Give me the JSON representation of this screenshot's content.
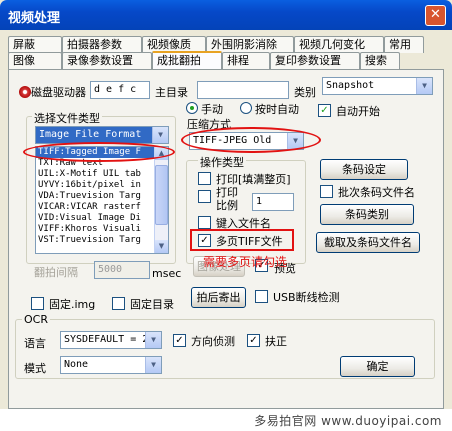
{
  "window": {
    "title": "视频处理",
    "close": "✕"
  },
  "tabs_row1": [
    "屏蔽",
    "拍摄器参数",
    "视频像质",
    "外围阴影消除",
    "视频几何变化",
    "常用"
  ],
  "tabs_row2": [
    "图像",
    "录像参数设置",
    "成批翻拍",
    "排程",
    "复印参数设置",
    "搜索"
  ],
  "active_tab": "成批翻拍",
  "disk": {
    "label": "磁盘驱动器",
    "value": "d e f c"
  },
  "main_dir": {
    "label": "主目录",
    "value": ""
  },
  "category": {
    "label": "类别",
    "value": "Snapshot"
  },
  "mode": {
    "manual": "手动",
    "timed": "按时自动",
    "selected": "手动"
  },
  "auto_start": {
    "label": "自动开始",
    "checked": true
  },
  "file_type": {
    "group_label": "选择文件类型",
    "combo_value": "Image File Format",
    "items": [
      "TIFF:Tagged Image F",
      "TXT:Raw text",
      "UIL:X-Motif UIL tab",
      "UYVY:16bit/pixel in",
      "VDA:Truevision Targ",
      "VICAR:VICAR rasterf",
      "VID:Visual Image Di",
      "VIFF:Khoros Visuali",
      "VST:Truevision Targ"
    ],
    "selected_index": 0
  },
  "compression": {
    "label": "压缩方式",
    "value": "TIFF-JPEG Old"
  },
  "operation": {
    "label": "操作类型",
    "print_fill": {
      "label": "打印[填满整页]",
      "checked": false
    },
    "print_scale": {
      "label1": "打印",
      "label2": "比例",
      "value": "1",
      "checked": false
    },
    "key_filename": {
      "label": "键入文件名",
      "checked": false
    },
    "multipage_tiff": {
      "label": "多页TIFF文件",
      "checked": true
    }
  },
  "barcode": {
    "settings": "条码设定",
    "batch_label": "批次条码文件名",
    "batch_checked": false,
    "category": "条码类别",
    "capture": "截取及条码文件名"
  },
  "flip_interval": {
    "label": "翻拍间隔",
    "value": "5000",
    "unit": "msec"
  },
  "image_process": {
    "label": "图像处理"
  },
  "preview": {
    "label": "预览",
    "checked": true
  },
  "annotation": "需要多页请勾选",
  "fixed_img": {
    "label": "固定.img",
    "checked": false
  },
  "fixed_dir": {
    "label": "固定目录",
    "checked": false
  },
  "capture_btn": "拍后寄出",
  "usb_detect": {
    "label": "USB断线检测",
    "checked": false
  },
  "ocr": {
    "group_label": "OCR",
    "language_label": "语言",
    "language_value": "SYSDEFAULT = 2(",
    "direction": {
      "label": "方向侦测",
      "checked": true
    },
    "deskew": {
      "label": "扶正",
      "checked": true
    },
    "mode_label": "模式",
    "mode_value": "None"
  },
  "ok_button": "确定",
  "watermark": "多易拍官网 www.duoyipai.com",
  "colors": {
    "titlebar": "#0648c8",
    "annotation_red": "#e21212",
    "check_green": "#21a121",
    "selection": "#316ac5"
  }
}
